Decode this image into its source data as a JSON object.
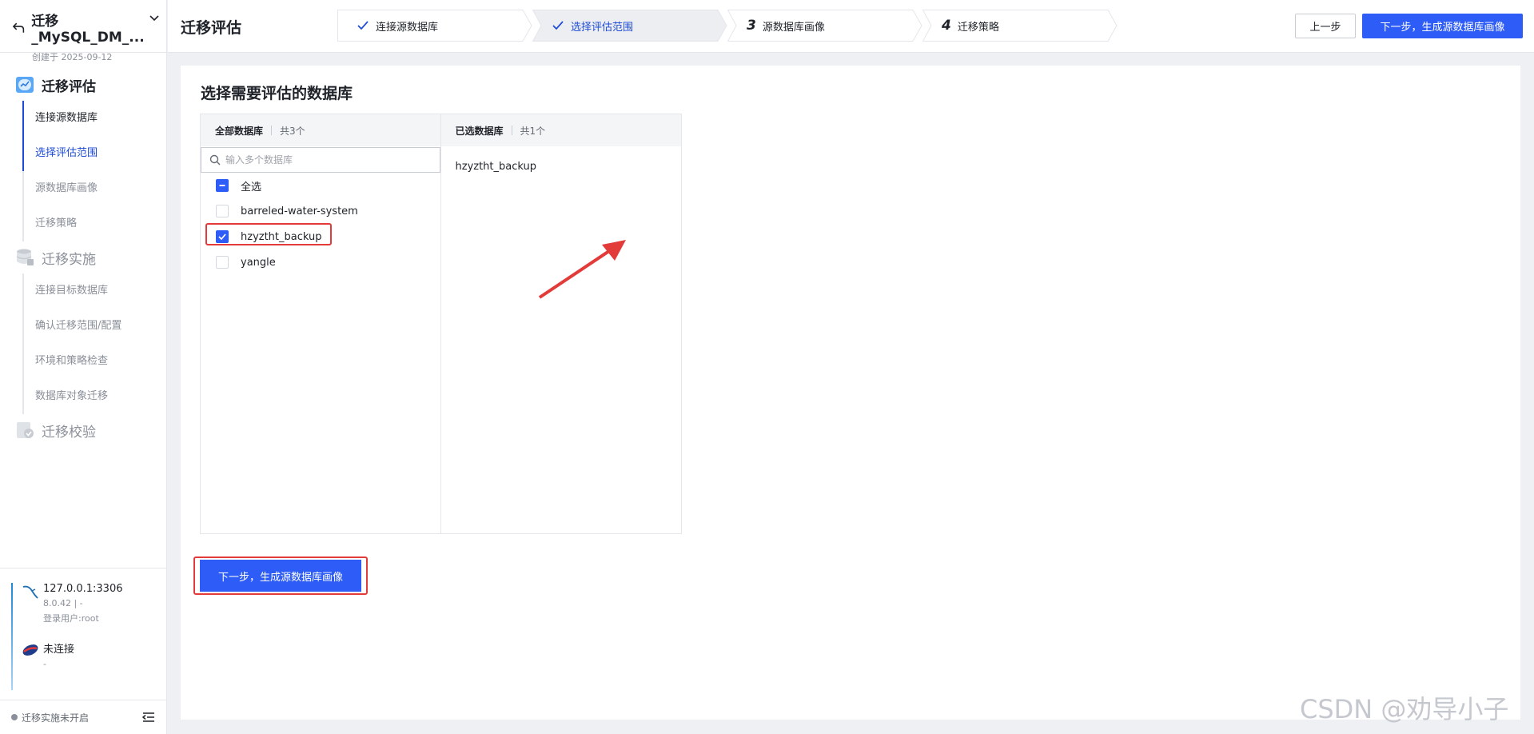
{
  "project": {
    "name": "迁移_MySQL_DM_...",
    "created": "创建于 2025-09-12"
  },
  "menu": {
    "groups": [
      {
        "label": "迁移评估",
        "items": [
          "连接源数据库",
          "选择评估范围",
          "源数据库画像",
          "迁移策略"
        ]
      },
      {
        "label": "迁移实施",
        "items": [
          "连接目标数据库",
          "确认迁移范围/配置",
          "环境和策略检查",
          "数据库对象迁移"
        ]
      },
      {
        "label": "迁移校验",
        "items": []
      }
    ]
  },
  "connections": [
    {
      "host": "127.0.0.1:3306",
      "version": "8.0.42 | -",
      "user": "登录用户:root"
    },
    {
      "host": "未连接",
      "version": "-"
    }
  ],
  "footer": {
    "status": "迁移实施未开启"
  },
  "topbar": {
    "title": "迁移评估",
    "steps": [
      {
        "label": "连接源数据库"
      },
      {
        "label": "选择评估范围"
      },
      {
        "num": "3",
        "label": "源数据库画像"
      },
      {
        "num": "4",
        "label": "迁移策略"
      }
    ],
    "prev": "上一步",
    "next": "下一步，生成源数据库画像"
  },
  "main": {
    "title": "选择需要评估的数据库",
    "all": {
      "title": "全部数据库",
      "count": "共3个",
      "placeholder": "输入多个数据库",
      "select_all": "全选",
      "items": [
        "barreled-water-system",
        "hzyztht_backup",
        "yangle"
      ]
    },
    "selected": {
      "title": "已选数据库",
      "count": "共1个",
      "items": [
        "hzyztht_backup"
      ]
    },
    "next": "下一步，生成源数据库画像"
  },
  "watermark": "CSDN @劝导小子",
  "colors": {
    "accent": "#2d5cf6",
    "highlight": "#e33a3a"
  }
}
